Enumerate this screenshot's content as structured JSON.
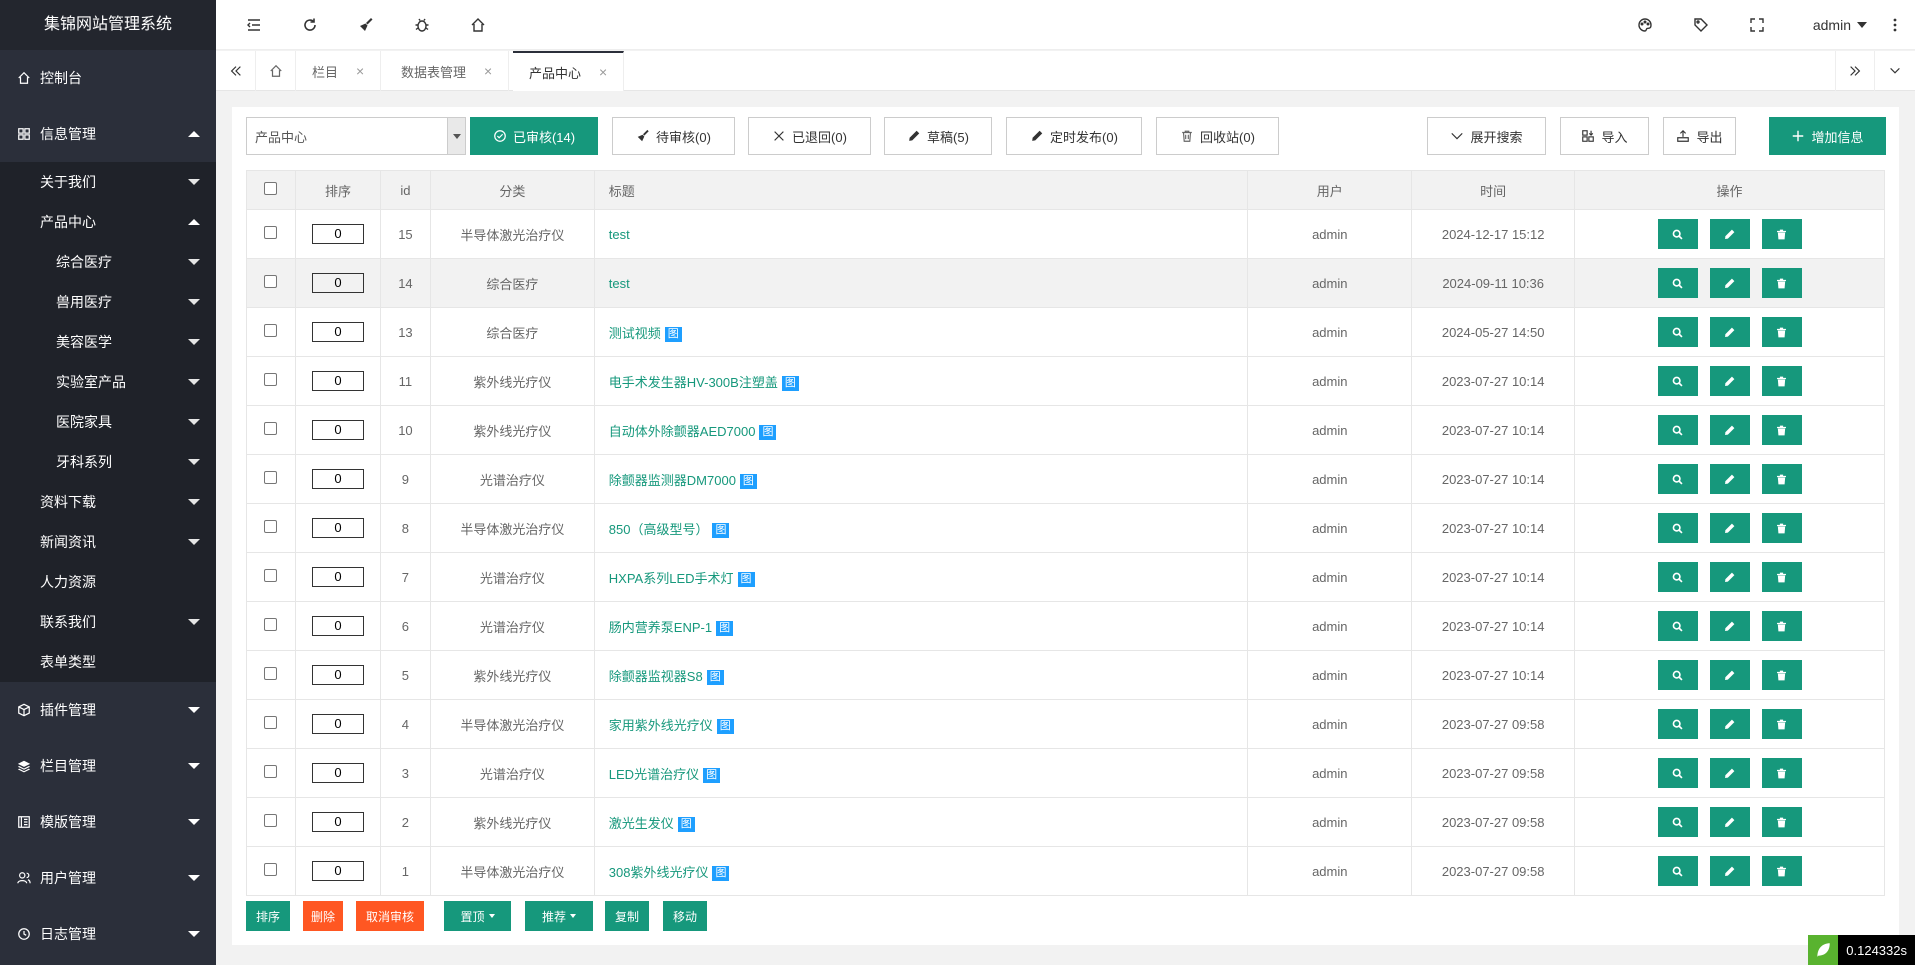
{
  "app": {
    "title": "集锦网站管理系统"
  },
  "sidebar": {
    "dashboard": "控制台",
    "info": "信息管理",
    "info_children": {
      "about": "关于我们",
      "products": "产品中心",
      "product_children": [
        "综合医疗",
        "兽用医疗",
        "美容医学",
        "实验室产品",
        "医院家具",
        "牙科系列"
      ],
      "downloads": "资料下载",
      "news": "新闻资讯",
      "hr": "人力资源",
      "contact": "联系我们",
      "forms": "表单类型"
    },
    "plugins": "插件管理",
    "columns": "栏目管理",
    "templates": "模版管理",
    "users": "用户管理",
    "logs": "日志管理"
  },
  "header": {
    "user": "admin"
  },
  "tabs": [
    {
      "label": "栏目"
    },
    {
      "label": "数据表管理"
    },
    {
      "label": "产品中心"
    }
  ],
  "toolbar": {
    "category_select": "产品中心",
    "approved": "已审核(14)",
    "pending": "待审核(0)",
    "returned": "已退回(0)",
    "drafts": "草稿(5)",
    "scheduled": "定时发布(0)",
    "recycle": "回收站(0)",
    "expand_search": "展开搜索",
    "import": "导入",
    "export": "导出",
    "add": "增加信息"
  },
  "table": {
    "headers": {
      "sort": "排序",
      "id": "id",
      "category": "分类",
      "title": "标题",
      "user": "用户",
      "time": "时间",
      "actions": "操作"
    },
    "image_badge": "图",
    "rows": [
      {
        "sort": "0",
        "id": "15",
        "category": "半导体激光治疗仪",
        "title": "test",
        "has_image": false,
        "user": "admin",
        "time": "2024-12-17 15:12"
      },
      {
        "sort": "0",
        "id": "14",
        "category": "综合医疗",
        "title": "test",
        "has_image": false,
        "user": "admin",
        "time": "2024-09-11 10:36"
      },
      {
        "sort": "0",
        "id": "13",
        "category": "综合医疗",
        "title": "测试视频",
        "has_image": true,
        "user": "admin",
        "time": "2024-05-27 14:50"
      },
      {
        "sort": "0",
        "id": "11",
        "category": "紫外线光疗仪",
        "title": "电手术发生器HV-300B注塑盖",
        "has_image": true,
        "user": "admin",
        "time": "2023-07-27 10:14"
      },
      {
        "sort": "0",
        "id": "10",
        "category": "紫外线光疗仪",
        "title": "自动体外除颤器AED7000",
        "has_image": true,
        "user": "admin",
        "time": "2023-07-27 10:14"
      },
      {
        "sort": "0",
        "id": "9",
        "category": "光谱治疗仪",
        "title": "除颤器监测器DM7000",
        "has_image": true,
        "user": "admin",
        "time": "2023-07-27 10:14"
      },
      {
        "sort": "0",
        "id": "8",
        "category": "半导体激光治疗仪",
        "title": "850（高级型号）",
        "has_image": true,
        "user": "admin",
        "time": "2023-07-27 10:14"
      },
      {
        "sort": "0",
        "id": "7",
        "category": "光谱治疗仪",
        "title": "HXPA系列LED手术灯",
        "has_image": true,
        "user": "admin",
        "time": "2023-07-27 10:14"
      },
      {
        "sort": "0",
        "id": "6",
        "category": "光谱治疗仪",
        "title": "肠内营养泵ENP-1",
        "has_image": true,
        "user": "admin",
        "time": "2023-07-27 10:14"
      },
      {
        "sort": "0",
        "id": "5",
        "category": "紫外线光疗仪",
        "title": "除颤器监视器S8",
        "has_image": true,
        "user": "admin",
        "time": "2023-07-27 10:14"
      },
      {
        "sort": "0",
        "id": "4",
        "category": "半导体激光治疗仪",
        "title": "家用紫外线光疗仪",
        "has_image": true,
        "user": "admin",
        "time": "2023-07-27 09:58"
      },
      {
        "sort": "0",
        "id": "3",
        "category": "光谱治疗仪",
        "title": "LED光谱治疗仪",
        "has_image": true,
        "user": "admin",
        "time": "2023-07-27 09:58"
      },
      {
        "sort": "0",
        "id": "2",
        "category": "紫外线光疗仪",
        "title": "激光生发仪",
        "has_image": true,
        "user": "admin",
        "time": "2023-07-27 09:58"
      },
      {
        "sort": "0",
        "id": "1",
        "category": "半导体激光治疗仪",
        "title": "308紫外线光疗仪",
        "has_image": true,
        "user": "admin",
        "time": "2023-07-27 09:58"
      }
    ]
  },
  "footer": {
    "sort": "排序",
    "delete": "删除",
    "unapprove": "取消审核",
    "pin": "置顶",
    "recommend": "推荐",
    "copy": "复制",
    "move": "移动"
  },
  "timer": "0.124332s",
  "colors": {
    "accent": "#16987c",
    "danger": "#ff5722",
    "badge": "#1e9fff",
    "sidebar": "#2b2f3a"
  }
}
